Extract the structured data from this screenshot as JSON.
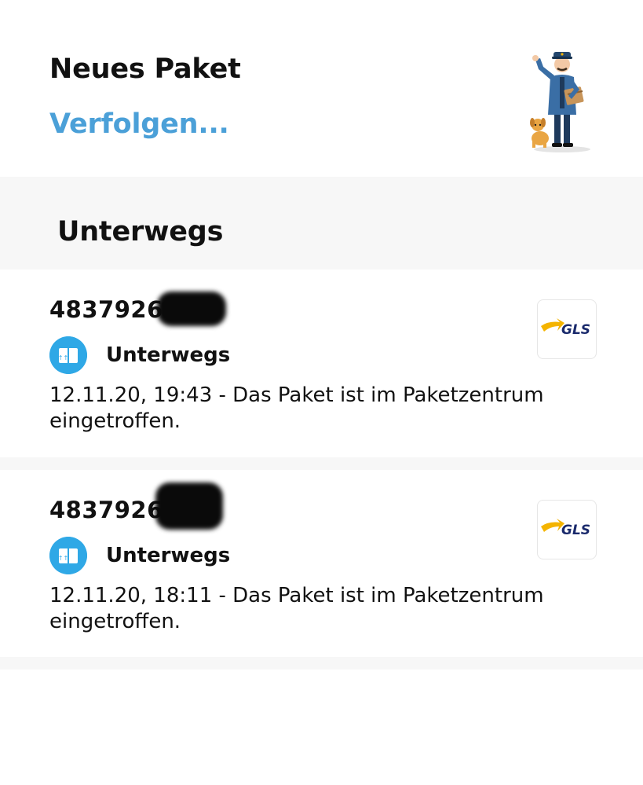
{
  "header": {
    "title": "Neues Paket",
    "track_link": "Verfolgen..."
  },
  "section": {
    "title": "Unterwegs"
  },
  "parcels": [
    {
      "tracking_number": "48379261",
      "status": "Unterwegs",
      "event": "12.11.20, 19:43 - Das Paket ist im Paketzentrum eingetroffen.",
      "carrier": "GLS"
    },
    {
      "tracking_number": "4837926",
      "status": "Unterwegs",
      "event": "12.11.20, 18:11 - Das Paket ist im Paketzentrum eingetroffen.",
      "carrier": "GLS"
    }
  ],
  "icons": {
    "status": "package-in-transit-icon",
    "carrier_logo": "gls-logo-icon",
    "mascot": "mail-carrier-illustration"
  },
  "colors": {
    "accent": "#4ba0d8",
    "status_icon": "#2fa8e6",
    "gls_yellow": "#f4b400",
    "gls_blue": "#1a2a6c"
  }
}
